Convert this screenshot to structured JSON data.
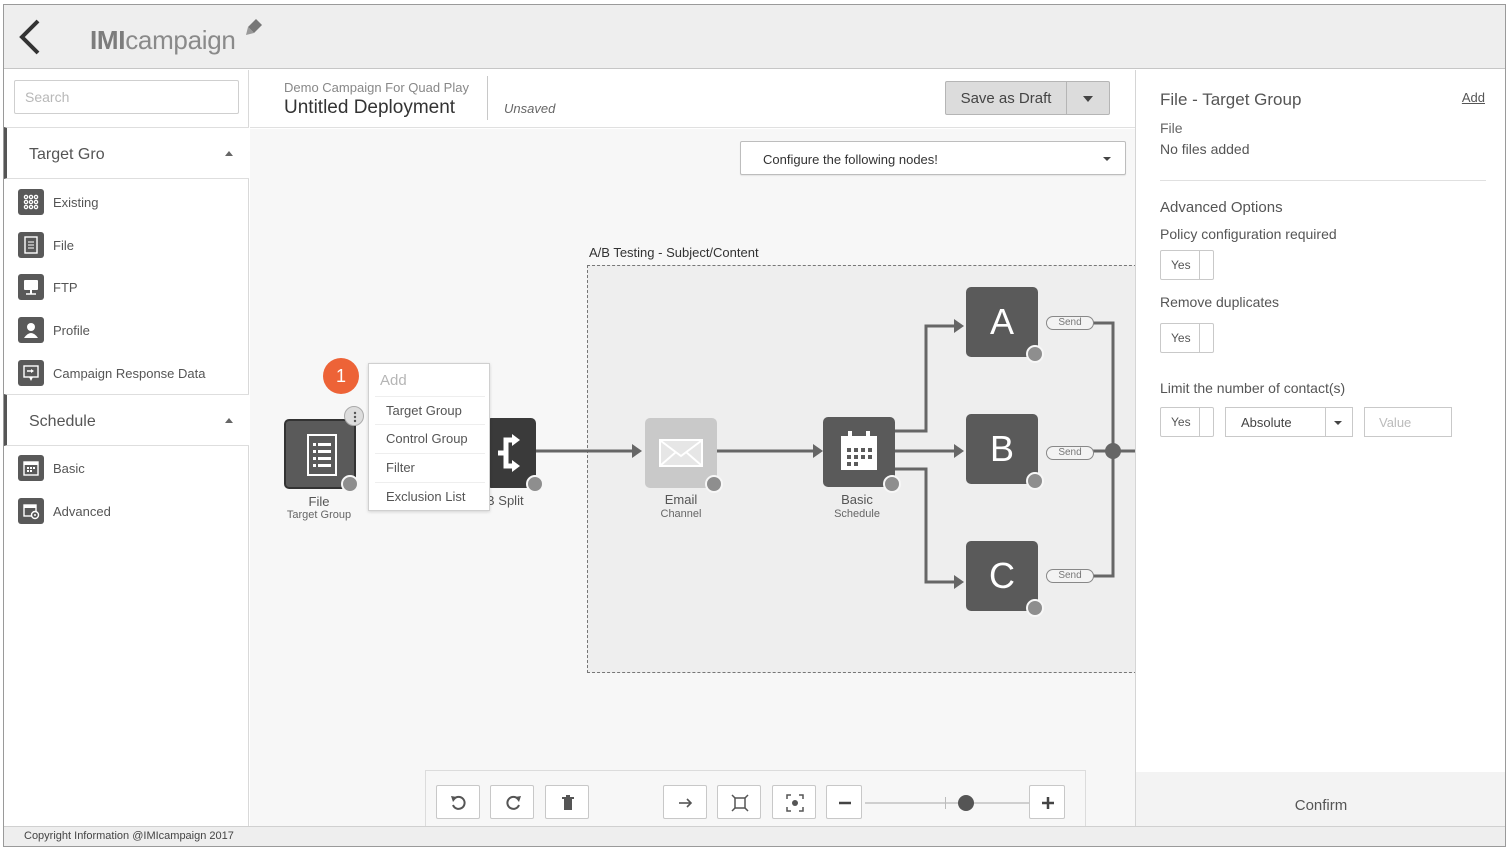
{
  "app": {
    "logo_bold": "IMI",
    "logo_rest": "campaign"
  },
  "sidebar": {
    "search_placeholder": "Search",
    "sections": [
      {
        "label": "Target Gro",
        "items": [
          "Existing",
          "File",
          "FTP",
          "Profile",
          "Campaign Response Data"
        ]
      },
      {
        "label": "Schedule",
        "items": [
          "Basic",
          "Advanced"
        ]
      }
    ]
  },
  "header": {
    "campaign_name": "Demo Campaign For Quad Play",
    "deployment_name": "Untitled Deployment",
    "status": "Unsaved",
    "save_label": "Save as Draft"
  },
  "canvas": {
    "config_select": "Configure the following nodes!",
    "ab_group_label": "A/B Testing - Subject/Content",
    "badge": "1",
    "add_menu": {
      "title": "Add",
      "items": [
        "Target Group",
        "Control Group",
        "Filter",
        "Exclusion List"
      ]
    },
    "nodes": {
      "file": {
        "title": "File",
        "subtitle": "Target Group"
      },
      "split": {
        "title": "B Split"
      },
      "email": {
        "title": "Email",
        "subtitle": "Channel"
      },
      "schedule": {
        "title": "Basic",
        "subtitle": "Schedule"
      },
      "variants": [
        {
          "letter": "A",
          "tag": "Send"
        },
        {
          "letter": "B",
          "tag": "Send"
        },
        {
          "letter": "C",
          "tag": "Send"
        }
      ]
    }
  },
  "toolbar": {
    "icons": [
      "undo-icon",
      "redo-icon",
      "trash-icon",
      "arrow-right-icon",
      "fit-screen-icon",
      "center-focus-icon",
      "zoom-out-icon",
      "zoom-in-icon"
    ]
  },
  "right_panel": {
    "title": "File - Target Group",
    "add_link": "Add",
    "file_label": "File",
    "file_value": "No files added",
    "advanced_title": "Advanced Options",
    "policy_label": "Policy configuration required",
    "policy_toggle": "Yes",
    "dup_label": "Remove duplicates",
    "dup_toggle": "Yes",
    "limit_label": "Limit the number of contact(s)",
    "limit_toggle": "Yes",
    "limit_type": "Absolute",
    "limit_value_placeholder": "Value",
    "confirm_label": "Confirm"
  },
  "footer": {
    "copyright": "Copyright Information @IMIcampaign 2017"
  },
  "colors": {
    "accent_badge": "#ed6337",
    "node_dark": "#5a5a5a",
    "node_light": "#c9c9c9"
  }
}
